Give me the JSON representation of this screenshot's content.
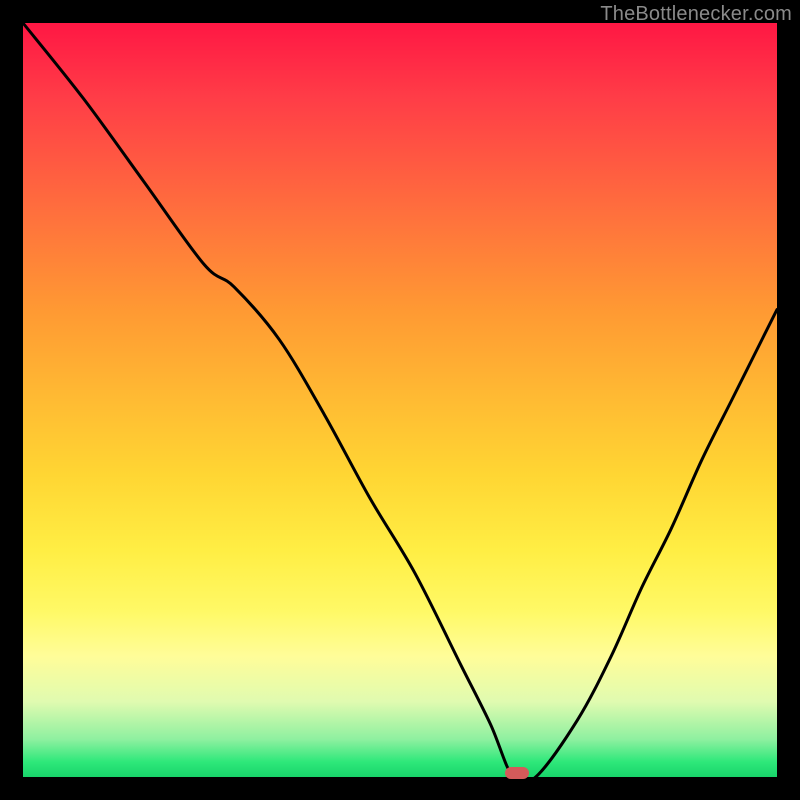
{
  "watermark": "TheBottlenecker.com",
  "optimum_fraction_x": 0.655,
  "chart_data": {
    "type": "line",
    "title": "",
    "xlabel": "",
    "ylabel": "",
    "xlim": [
      0,
      1
    ],
    "ylim": [
      0,
      1
    ],
    "series": [
      {
        "name": "bottleneck-curve",
        "x": [
          0.0,
          0.08,
          0.16,
          0.24,
          0.28,
          0.34,
          0.4,
          0.46,
          0.52,
          0.58,
          0.62,
          0.65,
          0.68,
          0.735,
          0.78,
          0.82,
          0.86,
          0.9,
          0.94,
          0.97,
          1.0
        ],
        "y": [
          1.0,
          0.9,
          0.79,
          0.68,
          0.65,
          0.58,
          0.48,
          0.37,
          0.27,
          0.15,
          0.07,
          0.0,
          0.0,
          0.075,
          0.16,
          0.25,
          0.33,
          0.42,
          0.5,
          0.56,
          0.62
        ]
      }
    ],
    "annotations": [
      {
        "name": "optimum-marker",
        "x": 0.655,
        "y": 0.0
      }
    ],
    "background_gradient": {
      "type": "vertical",
      "stops": [
        {
          "pos": 0.0,
          "color": "#ff1744"
        },
        {
          "pos": 0.5,
          "color": "#ffbb33"
        },
        {
          "pos": 0.78,
          "color": "#fffd99"
        },
        {
          "pos": 1.0,
          "color": "#18d46a"
        }
      ]
    }
  }
}
